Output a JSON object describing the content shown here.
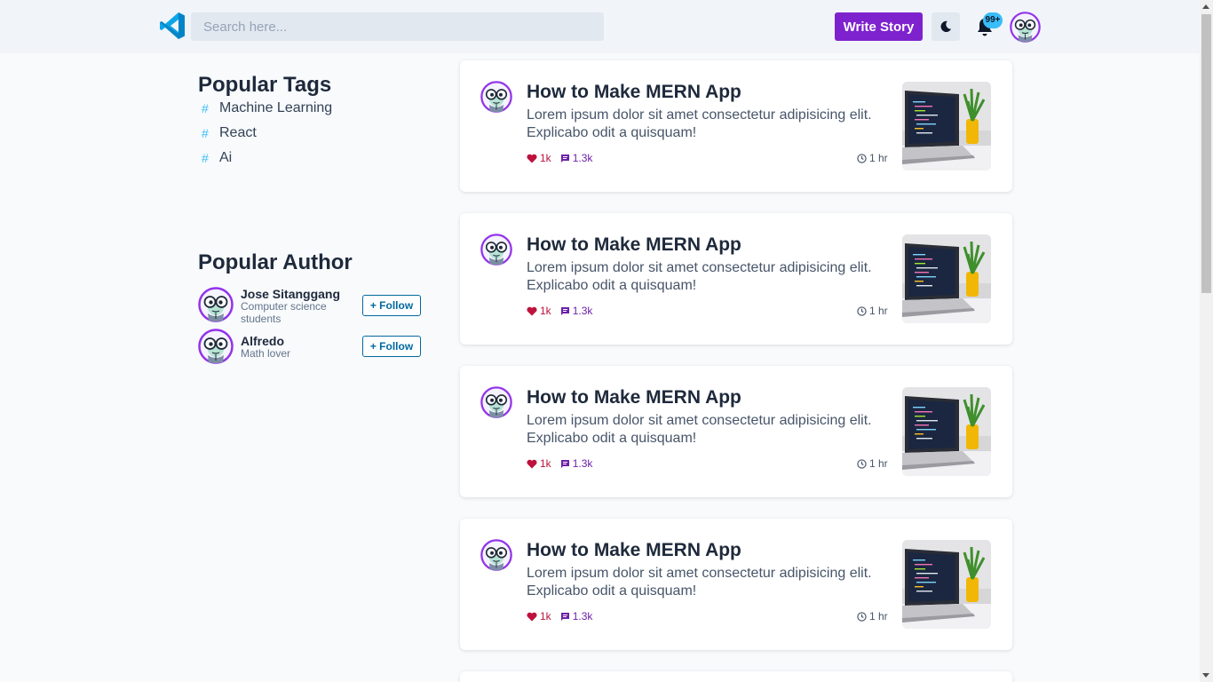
{
  "header": {
    "logo_icon": "vscode-logo-icon",
    "search_placeholder": "Search here...",
    "write_story_label": "Write Story",
    "theme_icon": "moon-icon",
    "notification_icon": "bell-icon",
    "notification_count": "99+",
    "avatar_icon": "user-avatar-icon"
  },
  "sidebar": {
    "tags_heading": "Popular Tags",
    "tags": [
      {
        "label": "Machine Learning"
      },
      {
        "label": "React"
      },
      {
        "label": "Ai"
      }
    ],
    "tag_symbol": "#",
    "authors_heading": "Popular Author",
    "authors": [
      {
        "name": "Jose Sitanggang",
        "bio": "Computer science students",
        "follow_label": "+ Follow"
      },
      {
        "name": "Alfredo",
        "bio": "Math lover",
        "follow_label": "+ Follow"
      }
    ]
  },
  "posts": [
    {
      "title": "How to Make MERN App",
      "excerpt": "Lorem ipsum dolor sit amet consectetur adipisicing elit. Explicabo odit a quisquam!",
      "likes": "1k",
      "comments": "1.3k",
      "time": "1 hr"
    },
    {
      "title": "How to Make MERN App",
      "excerpt": "Lorem ipsum dolor sit amet consectetur adipisicing elit. Explicabo odit a quisquam!",
      "likes": "1k",
      "comments": "1.3k",
      "time": "1 hr"
    },
    {
      "title": "How to Make MERN App",
      "excerpt": "Lorem ipsum dolor sit amet consectetur adipisicing elit. Explicabo odit a quisquam!",
      "likes": "1k",
      "comments": "1.3k",
      "time": "1 hr"
    },
    {
      "title": "How to Make MERN App",
      "excerpt": "Lorem ipsum dolor sit amet consectetur adipisicing elit. Explicabo odit a quisquam!",
      "likes": "1k",
      "comments": "1.3k",
      "time": "1 hr"
    }
  ],
  "colors": {
    "accent": "#7e22ce",
    "like": "#be123c",
    "comment": "#6b21a8",
    "follow": "#0369a1",
    "tag_hash": "#38bdf8"
  }
}
